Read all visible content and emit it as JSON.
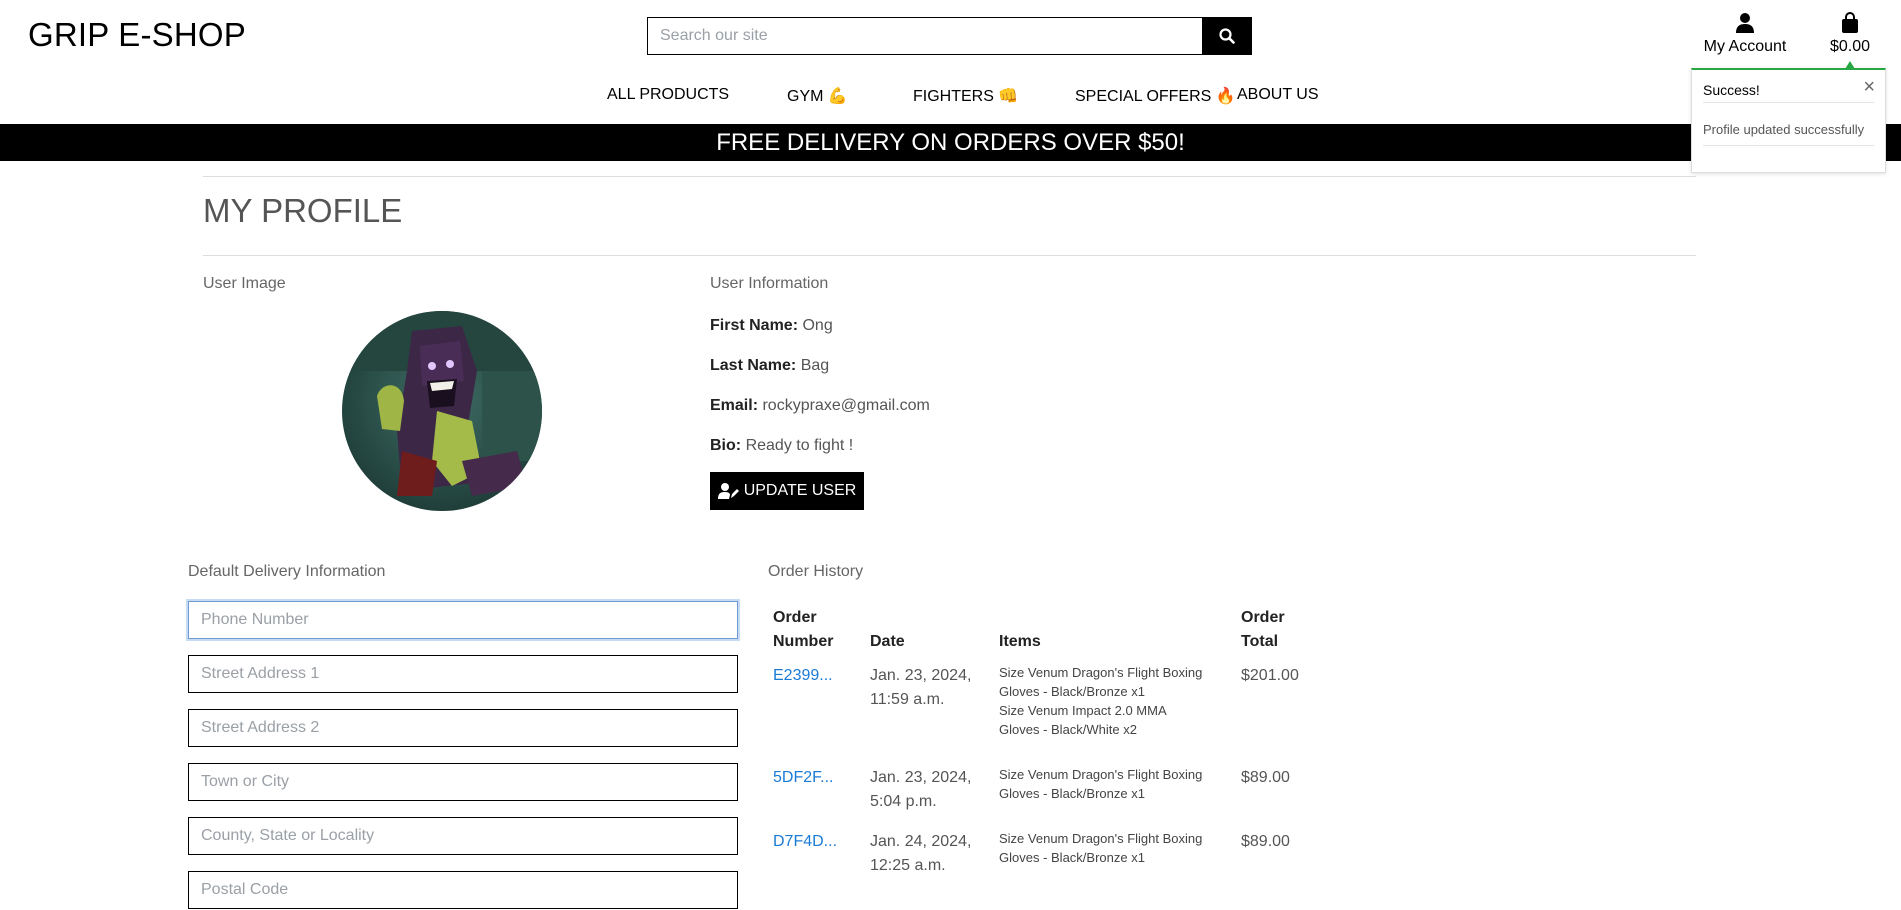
{
  "header": {
    "logo": "GRIP E-SHOP",
    "search_placeholder": "Search our site",
    "account_label": "My Account",
    "cart_total": "$0.00"
  },
  "nav": {
    "all_products": "ALL PRODUCTS",
    "gym": "GYM 💪",
    "fighters": "FIGHTERS 👊",
    "special_offers": "SPECIAL OFFERS 🔥",
    "about_us": "ABOUT US"
  },
  "banner": "FREE DELIVERY ON ORDERS OVER $50!",
  "toast": {
    "title": "Success!",
    "message": "Profile updated successfully",
    "close": "×",
    "accent_color": "#28a745"
  },
  "profile": {
    "title": "MY PROFILE",
    "user_image_label": "User Image",
    "user_info_label": "User Information",
    "first_name_label": "First Name:",
    "first_name": "Ong",
    "last_name_label": "Last Name:",
    "last_name": "Bag",
    "email_label": "Email:",
    "email": "rockypraxe@gmail.com",
    "bio_label": "Bio:",
    "bio": "Ready to fight !",
    "update_button": "UPDATE USER"
  },
  "delivery": {
    "label": "Default Delivery Information",
    "placeholders": {
      "phone": "Phone Number",
      "street1": "Street Address 1",
      "street2": "Street Address 2",
      "town": "Town or City",
      "county": "County, State or Locality",
      "postal": "Postal Code"
    }
  },
  "orders": {
    "label": "Order History",
    "headers": {
      "number_1": "Order",
      "number_2": "Number",
      "date": "Date",
      "items": "Items",
      "total_1": "Order",
      "total_2": "Total"
    },
    "rows": [
      {
        "number": "E2399...",
        "date_1": "Jan. 23, 2024,",
        "date_2": "11:59 a.m.",
        "items": [
          "Size Venum Dragon's Flight Boxing Gloves - Black/Bronze x1",
          "Size Venum Impact 2.0 MMA Gloves - Black/White x2"
        ],
        "total": "$201.00"
      },
      {
        "number": "5DF2F...",
        "date_1": "Jan. 23, 2024,",
        "date_2": "5:04 p.m.",
        "items": [
          "Size Venum Dragon's Flight Boxing Gloves - Black/Bronze x1"
        ],
        "total": "$89.00"
      },
      {
        "number": "D7F4D...",
        "date_1": "Jan. 24, 2024,",
        "date_2": "12:25 a.m.",
        "items": [
          "Size Venum Dragon's Flight Boxing Gloves - Black/Bronze x1"
        ],
        "total": "$89.00"
      }
    ]
  }
}
